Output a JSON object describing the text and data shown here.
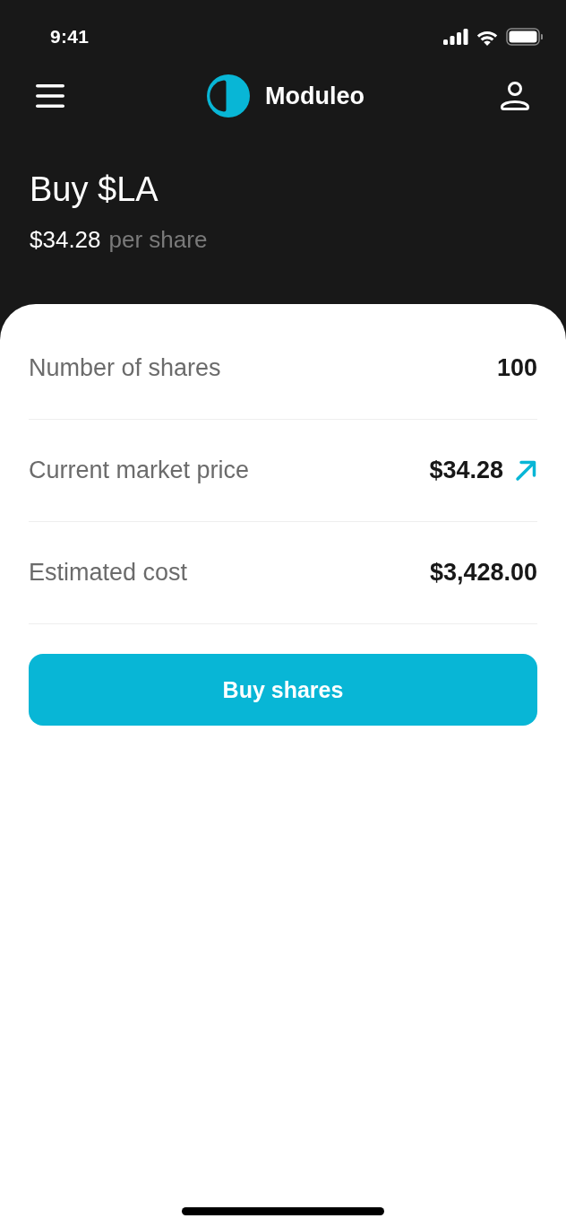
{
  "status_bar": {
    "time": "9:41"
  },
  "nav": {
    "brand": "Moduleo"
  },
  "header": {
    "title": "Buy $LA",
    "price": "$34.28",
    "price_unit": "per share"
  },
  "rows": [
    {
      "kind": "plain",
      "label": "Number of shares",
      "value": "100"
    },
    {
      "kind": "trend",
      "label": "Current market price",
      "value": "$34.28"
    },
    {
      "kind": "plain",
      "label": "Estimated cost",
      "value": "$3,428.00"
    }
  ],
  "buy_button": {
    "label": "Buy shares"
  }
}
